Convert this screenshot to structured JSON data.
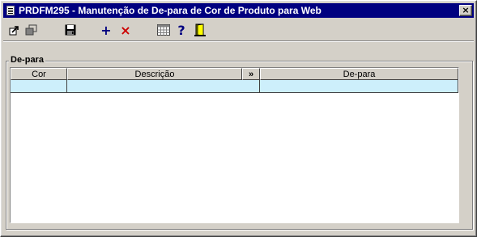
{
  "window": {
    "title": "PRDFM295 - Manutenção de De-para de Cor de Produto para Web",
    "close_label": "×"
  },
  "toolbar": {
    "items": [
      {
        "name": "navigate-icon"
      },
      {
        "name": "copy-icon"
      },
      {
        "name": "save-icon"
      },
      {
        "name": "add-icon",
        "label": "+",
        "color": "#000080"
      },
      {
        "name": "delete-icon",
        "label": "×",
        "color": "#cc0000"
      },
      {
        "name": "grid-icon"
      },
      {
        "name": "help-icon",
        "label": "?",
        "color": "#000080"
      },
      {
        "name": "exit-door-icon"
      }
    ]
  },
  "group": {
    "label": "De-para"
  },
  "grid": {
    "columns": [
      {
        "label": "Cor"
      },
      {
        "label": "Descrição"
      },
      {
        "label": "»"
      },
      {
        "label": "De-para"
      }
    ],
    "rows": [
      {
        "cor": "",
        "descricao": "",
        "depara": ""
      }
    ],
    "selected_row_color": "#cdeffb"
  }
}
